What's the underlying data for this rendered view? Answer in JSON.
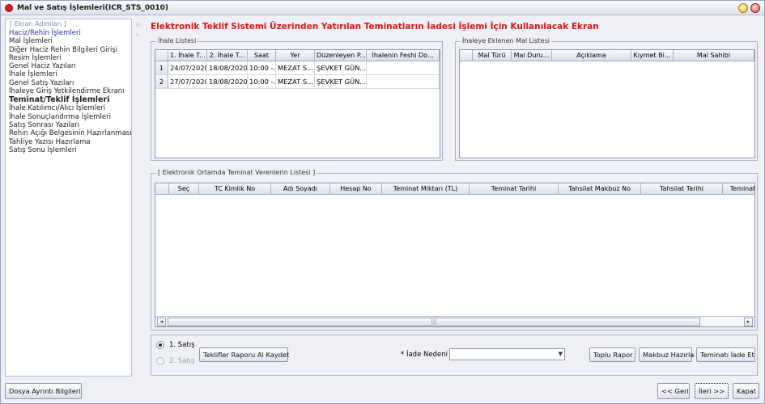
{
  "window": {
    "title": "Mal ve Satış İşlemleri(ICR_STS_0010)"
  },
  "sidebar": {
    "legend": "[ Ekran Adımları ]",
    "items": [
      {
        "label": "Haciz/Rehin İşlemleri",
        "state": "active"
      },
      {
        "label": "Mal İşlemleri",
        "state": "normal"
      },
      {
        "label": "Diğer Haciz Rehin Bilgileri Girişi",
        "state": "normal"
      },
      {
        "label": "Resim İşlemleri",
        "state": "normal"
      },
      {
        "label": "Genel Haciz Yazıları",
        "state": "normal"
      },
      {
        "label": "İhale İşlemleri",
        "state": "normal"
      },
      {
        "label": "Genel Satış Yazıları",
        "state": "normal"
      },
      {
        "label": "İhaleye Giriş Yetkilendirme Ekranı",
        "state": "normal"
      },
      {
        "label": "Teminat/Teklif İşlemleri",
        "state": "current"
      },
      {
        "label": "İhale Katılımcı/Alıcı İşlemleri",
        "state": "normal"
      },
      {
        "label": "İhale Sonuçlandırma İşlemleri",
        "state": "normal"
      },
      {
        "label": "Satış Sonrası Yazıları",
        "state": "normal"
      },
      {
        "label": "Rehin Açığı Belgesinin Hazırlanması",
        "state": "normal"
      },
      {
        "label": "Tahliye Yazısı Hazırlama",
        "state": "normal"
      },
      {
        "label": "Satış Sonu İşlemleri",
        "state": "normal"
      }
    ]
  },
  "screen_title": "Elektronik Teklif Sistemi Üzerinden Yatırılan Teminatların İadesi İşlemi İçin Kullanılacak Ekran",
  "ihale_listesi": {
    "legend": "İhale Listesi",
    "columns": [
      "",
      "1. İhale T...",
      "2. İhale T...",
      "Saat",
      "Yer",
      "Düzenleyen P...",
      "İhalenin Feshi Do..."
    ],
    "rows": [
      [
        "1",
        "24/07/2020",
        "18/08/2020",
        "10:00 -...",
        "MEZAT S...",
        "ŞEVKET GÜN...",
        ""
      ],
      [
        "2",
        "27/07/2020",
        "18/08/2020",
        "10:00 -...",
        "MEZAT S...",
        "ŞEVKET GÜN...",
        ""
      ]
    ]
  },
  "mal_listesi": {
    "legend": "İhaleye Eklenen Mal Listesi",
    "columns": [
      "",
      "Mal Türü",
      "Mal Duru...",
      "Açıklama",
      "Kıymet Bi...",
      "Mal Sahibi"
    ]
  },
  "teminat_listesi": {
    "legend": "[ Elektronik Ortamda Teminat Verenlerin Listesi ]",
    "columns": [
      "",
      "Seç",
      "TC Kimlik No",
      "Adı Soyadı",
      "Hesap No",
      "Teminat Miktarı (TL)",
      "Teminat Tarihi",
      "Tahsilat Makbuz No",
      "Tahsilat Tarihi",
      "Teminat"
    ]
  },
  "bottom": {
    "radio_satis1": "1. Satış",
    "radio_satis2": "2. Satış",
    "rapor_button": "Teklifler Raporu Al Kaydet",
    "iade_nedeni_label": "* İade Nedeni",
    "iade_nedeni_value": "",
    "toplu_rapor_button": "Toplu Rapor",
    "makbuz_hazirla_button": "Makbuz Hazırla",
    "teminati_iade_button": "Teminatı İade Et"
  },
  "footer": {
    "dosya_ayrinti_button": "Dosya Ayrıntı Bilgileri",
    "geri_button": "<< Geri",
    "ileri_button": "İleri >>",
    "kapat_button": "Kapat"
  },
  "scroll_icons": {
    "left": "arrow-left-icon",
    "right": "arrow-right-icon",
    "grip": "scroll-grip-icon"
  }
}
